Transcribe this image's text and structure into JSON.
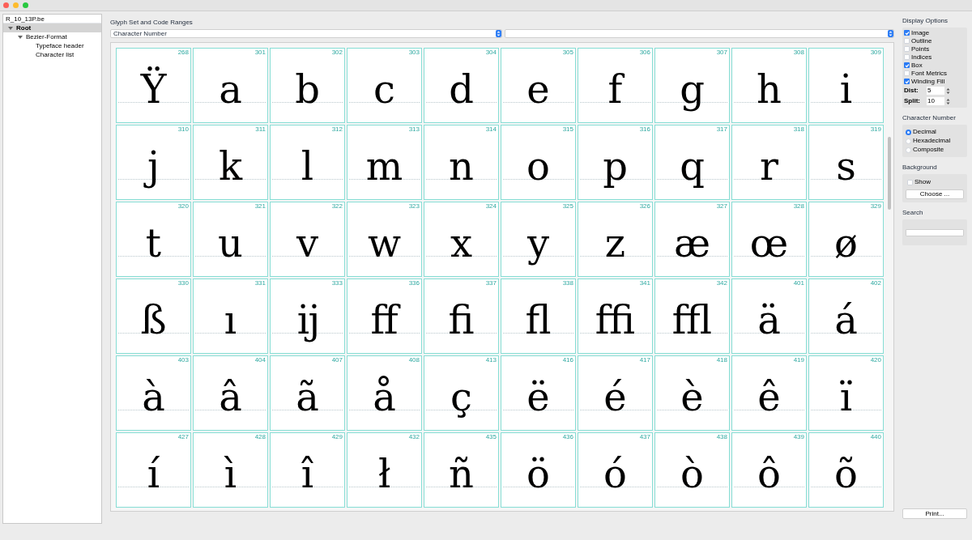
{
  "file_tree": {
    "file_name": "R_10_13P.be",
    "root": {
      "label": "Root",
      "expanded": true,
      "selected": true,
      "children": [
        {
          "label": "Bezier-Format",
          "expanded": true,
          "selected": false,
          "children": [
            {
              "label": "Typeface header",
              "selected": false
            },
            {
              "label": "Character list",
              "selected": false
            }
          ]
        }
      ]
    }
  },
  "glyph_set": {
    "label": "Glyph Set and Code Ranges",
    "dropdown_1": "Character Number"
  },
  "glyphs": [
    {
      "number": "268",
      "char": "Ÿ"
    },
    {
      "number": "301",
      "char": "a"
    },
    {
      "number": "302",
      "char": "b"
    },
    {
      "number": "303",
      "char": "c"
    },
    {
      "number": "304",
      "char": "d"
    },
    {
      "number": "305",
      "char": "e"
    },
    {
      "number": "306",
      "char": "f"
    },
    {
      "number": "307",
      "char": "g"
    },
    {
      "number": "308",
      "char": "h"
    },
    {
      "number": "309",
      "char": "i"
    },
    {
      "number": "310",
      "char": "j"
    },
    {
      "number": "311",
      "char": "k"
    },
    {
      "number": "312",
      "char": "l"
    },
    {
      "number": "313",
      "char": "m"
    },
    {
      "number": "314",
      "char": "n"
    },
    {
      "number": "315",
      "char": "o"
    },
    {
      "number": "316",
      "char": "p"
    },
    {
      "number": "317",
      "char": "q"
    },
    {
      "number": "318",
      "char": "r"
    },
    {
      "number": "319",
      "char": "s"
    },
    {
      "number": "320",
      "char": "t"
    },
    {
      "number": "321",
      "char": "u"
    },
    {
      "number": "322",
      "char": "v"
    },
    {
      "number": "323",
      "char": "w"
    },
    {
      "number": "324",
      "char": "x"
    },
    {
      "number": "325",
      "char": "y"
    },
    {
      "number": "326",
      "char": "z"
    },
    {
      "number": "327",
      "char": "æ"
    },
    {
      "number": "328",
      "char": "œ"
    },
    {
      "number": "329",
      "char": "ø"
    },
    {
      "number": "330",
      "char": "ß"
    },
    {
      "number": "331",
      "char": "ı"
    },
    {
      "number": "333",
      "char": "ĳ"
    },
    {
      "number": "336",
      "char": "ﬀ"
    },
    {
      "number": "337",
      "char": "ﬁ"
    },
    {
      "number": "338",
      "char": "ﬂ"
    },
    {
      "number": "341",
      "char": "ﬃ"
    },
    {
      "number": "342",
      "char": "ﬄ"
    },
    {
      "number": "401",
      "char": "ä"
    },
    {
      "number": "402",
      "char": "á"
    },
    {
      "number": "403",
      "char": "à"
    },
    {
      "number": "404",
      "char": "â"
    },
    {
      "number": "407",
      "char": "ã"
    },
    {
      "number": "408",
      "char": "å"
    },
    {
      "number": "413",
      "char": "ç"
    },
    {
      "number": "416",
      "char": "ë"
    },
    {
      "number": "417",
      "char": "é"
    },
    {
      "number": "418",
      "char": "è"
    },
    {
      "number": "419",
      "char": "ê"
    },
    {
      "number": "420",
      "char": "ï"
    },
    {
      "number": "427",
      "char": "í"
    },
    {
      "number": "428",
      "char": "ì"
    },
    {
      "number": "429",
      "char": "î"
    },
    {
      "number": "432",
      "char": "ł"
    },
    {
      "number": "435",
      "char": "ñ"
    },
    {
      "number": "436",
      "char": "ö"
    },
    {
      "number": "437",
      "char": "ó"
    },
    {
      "number": "438",
      "char": "ò"
    },
    {
      "number": "439",
      "char": "ô"
    },
    {
      "number": "440",
      "char": "õ"
    }
  ],
  "display_options": {
    "title": "Display Options",
    "options": [
      {
        "label": "Image",
        "checked": true
      },
      {
        "label": "Outline",
        "checked": false
      },
      {
        "label": "Points",
        "checked": false
      },
      {
        "label": "Indices",
        "checked": false
      },
      {
        "label": "Box",
        "checked": true
      },
      {
        "label": "Font Metrics",
        "checked": false
      },
      {
        "label": "Winding Fill",
        "checked": true
      }
    ],
    "dist": {
      "label": "Dist:",
      "value": "5"
    },
    "split": {
      "label": "Split:",
      "value": "10"
    }
  },
  "character_number": {
    "title": "Character Number",
    "options": [
      {
        "label": "Decimal",
        "selected": true
      },
      {
        "label": "Hexadecimal",
        "selected": false
      },
      {
        "label": "Composite",
        "selected": false
      }
    ]
  },
  "background": {
    "title": "Background",
    "show": {
      "label": "Show",
      "checked": false
    },
    "choose_button": "Choose ..."
  },
  "search": {
    "title": "Search"
  },
  "print_button": "Print..."
}
